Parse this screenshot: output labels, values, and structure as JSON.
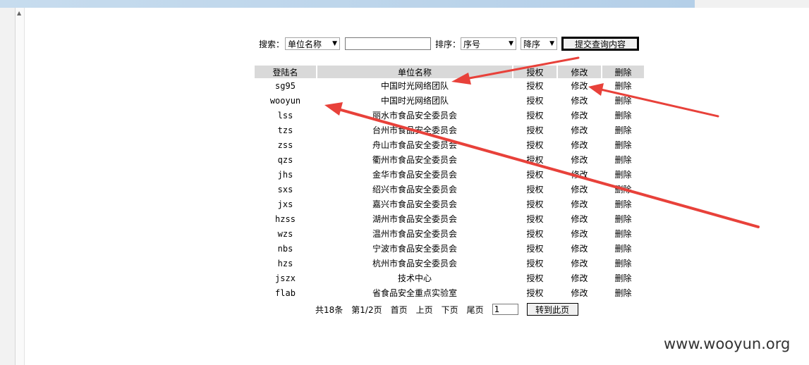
{
  "search": {
    "label": "搜索：",
    "field_select": "单位名称",
    "input_value": "",
    "sort_label": "排序：",
    "sort_field": "序号",
    "sort_order": "降序",
    "submit_label": "提交查询内容"
  },
  "table": {
    "headers": [
      "登陆名",
      "单位名称",
      "授权",
      "修改",
      "删除"
    ],
    "rows": [
      {
        "login": "sg95",
        "unit": "中国时光网络团队",
        "auth": "授权",
        "edit": "修改",
        "del": "删除"
      },
      {
        "login": "wooyun",
        "unit": "中国时光网络团队",
        "auth": "授权",
        "edit": "修改",
        "del": "删除"
      },
      {
        "login": "lss",
        "unit": "丽水市食品安全委员会",
        "auth": "授权",
        "edit": "修改",
        "del": "删除"
      },
      {
        "login": "tzs",
        "unit": "台州市食品安全委员会",
        "auth": "授权",
        "edit": "修改",
        "del": "删除"
      },
      {
        "login": "zss",
        "unit": "舟山市食品安全委员会",
        "auth": "授权",
        "edit": "修改",
        "del": "删除"
      },
      {
        "login": "qzs",
        "unit": "衢州市食品安全委员会",
        "auth": "授权",
        "edit": "修改",
        "del": "删除"
      },
      {
        "login": "jhs",
        "unit": "金华市食品安全委员会",
        "auth": "授权",
        "edit": "修改",
        "del": "删除"
      },
      {
        "login": "sxs",
        "unit": "绍兴市食品安全委员会",
        "auth": "授权",
        "edit": "修改",
        "del": "删除"
      },
      {
        "login": "jxs",
        "unit": "嘉兴市食品安全委员会",
        "auth": "授权",
        "edit": "修改",
        "del": "删除"
      },
      {
        "login": "hzss",
        "unit": "湖州市食品安全委员会",
        "auth": "授权",
        "edit": "修改",
        "del": "删除"
      },
      {
        "login": "wzs",
        "unit": "温州市食品安全委员会",
        "auth": "授权",
        "edit": "修改",
        "del": "删除"
      },
      {
        "login": "nbs",
        "unit": "宁波市食品安全委员会",
        "auth": "授权",
        "edit": "修改",
        "del": "删除"
      },
      {
        "login": "hzs",
        "unit": "杭州市食品安全委员会",
        "auth": "授权",
        "edit": "修改",
        "del": "删除"
      },
      {
        "login": "jszx",
        "unit": "技术中心",
        "auth": "授权",
        "edit": "修改",
        "del": "删除"
      },
      {
        "login": "flab",
        "unit": "省食品安全重点实验室",
        "auth": "授权",
        "edit": "修改",
        "del": "删除"
      }
    ]
  },
  "pager": {
    "total": "共18条",
    "page": "第1/2页",
    "first": "首页",
    "prev": "上页",
    "next": "下页",
    "last": "尾页",
    "page_input": "1",
    "go_label": "转到此页"
  },
  "watermark": "www.wooyun.org",
  "colors": {
    "annotation_arrow": "#e8413a",
    "header_bg": "#d9d9d9"
  }
}
